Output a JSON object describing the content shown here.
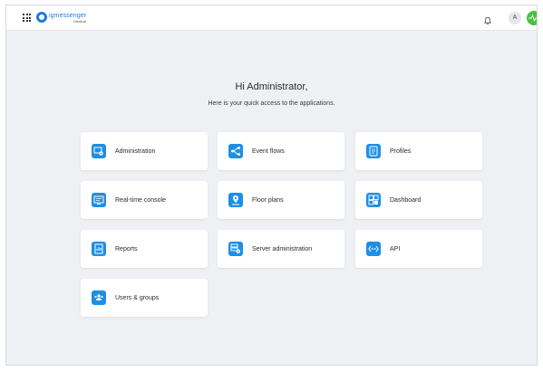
{
  "header": {
    "logo_name": "igmessenger",
    "logo_sub": "Medical",
    "avatar_initial": "A"
  },
  "main": {
    "greeting": "Hi Administrator,",
    "subtitle": "Here is your quick access to the applications."
  },
  "apps": [
    {
      "label": "Administration",
      "icon": "administration-icon"
    },
    {
      "label": "Event flows",
      "icon": "event-flows-icon"
    },
    {
      "label": "Profiles",
      "icon": "profiles-icon"
    },
    {
      "label": "Real-time console",
      "icon": "real-time-console-icon"
    },
    {
      "label": "Floor plans",
      "icon": "floor-plans-icon"
    },
    {
      "label": "Dashboard",
      "icon": "dashboard-icon"
    },
    {
      "label": "Reports",
      "icon": "reports-icon"
    },
    {
      "label": "Server administration",
      "icon": "server-administration-icon"
    },
    {
      "label": "API",
      "icon": "api-icon"
    },
    {
      "label": "Users & groups",
      "icon": "users-groups-icon"
    }
  ],
  "colors": {
    "accent": "#1e8fe6",
    "brand": "#1f7bd8",
    "status_online": "#49c23d",
    "background": "#eef0f3"
  }
}
